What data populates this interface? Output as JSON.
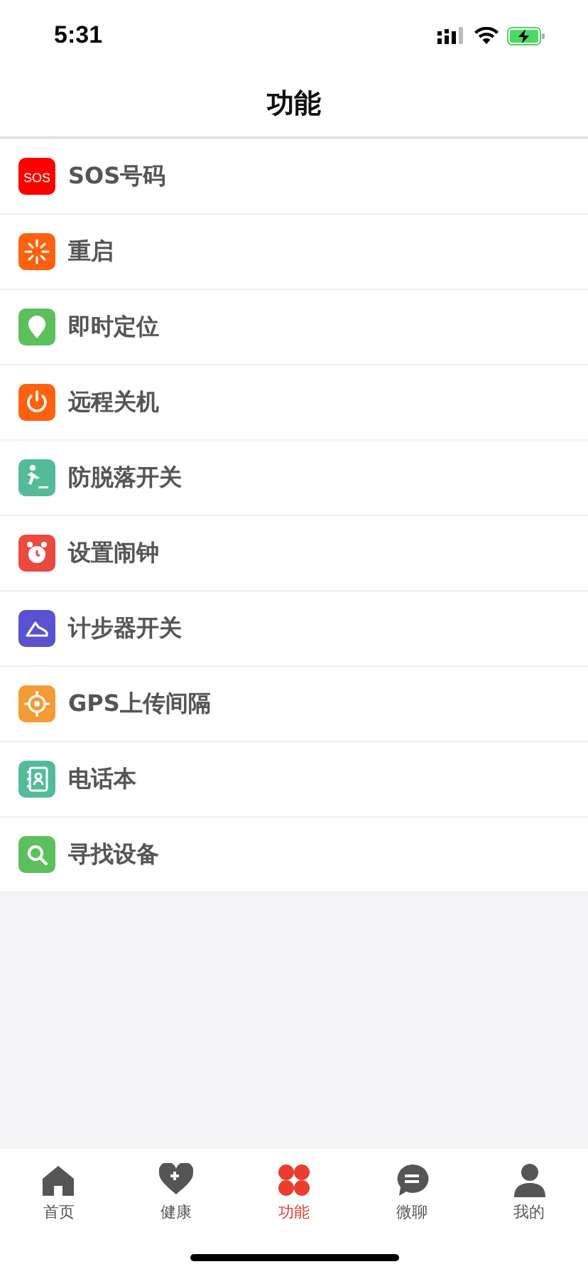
{
  "status_bar": {
    "time": "5:31"
  },
  "header": {
    "title": "功能"
  },
  "items": [
    {
      "label": "SOS号码",
      "kind": "sos",
      "icon_text": "SOS",
      "color": "#fe0000"
    },
    {
      "label": "重启",
      "kind": "restart",
      "color": "#fe6211"
    },
    {
      "label": "即时定位",
      "kind": "locate",
      "color": "#5cc05d"
    },
    {
      "label": "远程关机",
      "kind": "power",
      "color": "#fe6211"
    },
    {
      "label": "防脱落开关",
      "kind": "fall",
      "color": "#53bc97"
    },
    {
      "label": "设置闹钟",
      "kind": "alarm",
      "color": "#ea4a40"
    },
    {
      "label": "计步器开关",
      "kind": "shoe",
      "color": "#5a51d0"
    },
    {
      "label": "GPS上传间隔",
      "kind": "target",
      "color": "#f49b35"
    },
    {
      "label": "电话本",
      "kind": "book",
      "color": "#53bc97"
    },
    {
      "label": "寻找设备",
      "kind": "search",
      "color": "#5cc05d"
    }
  ],
  "tab_bar": [
    {
      "label": "首页",
      "kind": "home",
      "selected": false
    },
    {
      "label": "健康",
      "kind": "health",
      "selected": false
    },
    {
      "label": "功能",
      "kind": "clover",
      "selected": true
    },
    {
      "label": "微聊",
      "kind": "chat",
      "selected": false
    },
    {
      "label": "我的",
      "kind": "person",
      "selected": false
    }
  ]
}
